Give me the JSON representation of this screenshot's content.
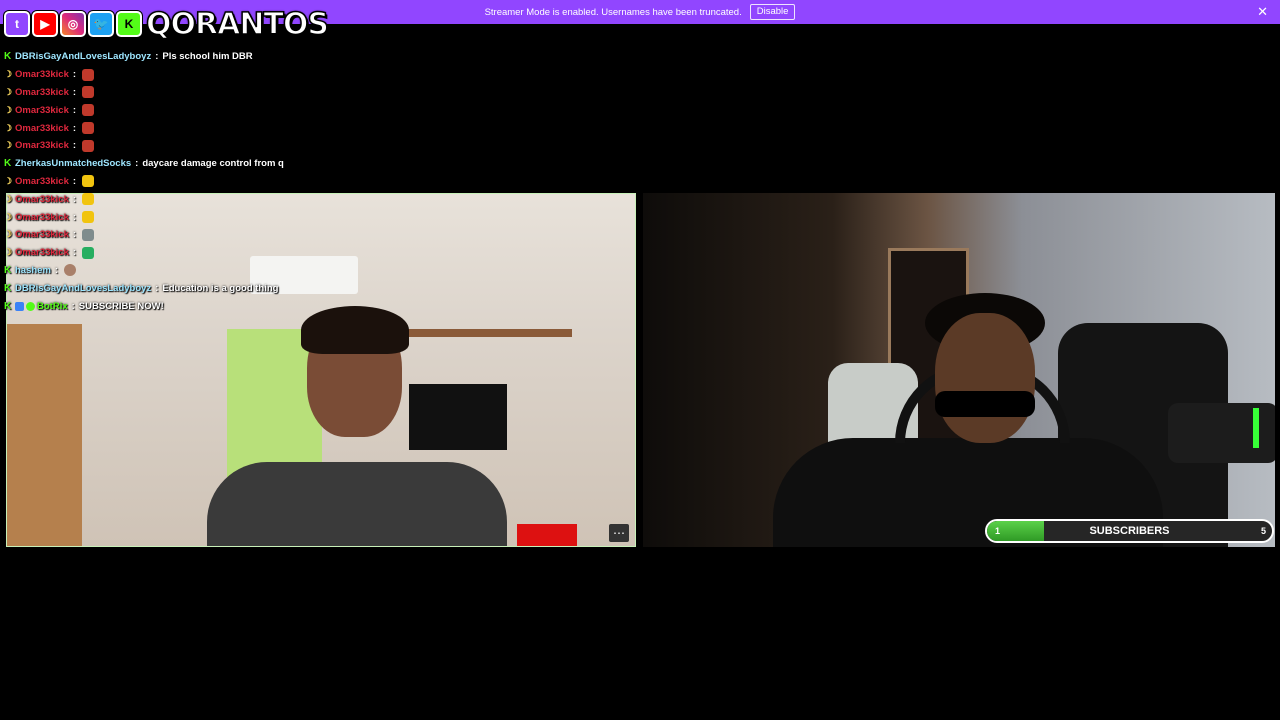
{
  "banner": {
    "message": "Streamer Mode is enabled. Usernames have been truncated.",
    "disable_label": "Disable",
    "close_glyph": "✕"
  },
  "logo": {
    "text": "QORANTOS",
    "socials": [
      "twitch-icon",
      "youtube-icon",
      "instagram-icon",
      "twitter-icon",
      "kick-icon"
    ]
  },
  "chat": [
    {
      "badge": "kick",
      "user": "DBRisGayAndLovesLadyboyz",
      "user_color": "#9ee6ff",
      "text": "Pls school him DBR",
      "emote": ""
    },
    {
      "badge": "moon",
      "user": "Omar33kick",
      "user_color": "#e0283e",
      "text": "",
      "emote": "red"
    },
    {
      "badge": "moon",
      "user": "Omar33kick",
      "user_color": "#e0283e",
      "text": "",
      "emote": "red"
    },
    {
      "badge": "moon",
      "user": "Omar33kick",
      "user_color": "#e0283e",
      "text": "",
      "emote": "red"
    },
    {
      "badge": "moon",
      "user": "Omar33kick",
      "user_color": "#e0283e",
      "text": "",
      "emote": "red"
    },
    {
      "badge": "moon",
      "user": "Omar33kick",
      "user_color": "#e0283e",
      "text": "",
      "emote": "red"
    },
    {
      "badge": "kick",
      "user": "ZherkasUnmatchedSocks",
      "user_color": "#9ee6ff",
      "text": "daycare damage control from q",
      "emote": ""
    },
    {
      "badge": "moon",
      "user": "Omar33kick",
      "user_color": "#e0283e",
      "text": "",
      "emote": "yellow"
    },
    {
      "badge": "moon",
      "user": "Omar33kick",
      "user_color": "#e0283e",
      "text": "",
      "emote": "yellow"
    },
    {
      "badge": "moon",
      "user": "Omar33kick",
      "user_color": "#e0283e",
      "text": "",
      "emote": "yellow"
    },
    {
      "badge": "moon",
      "user": "Omar33kick",
      "user_color": "#e0283e",
      "text": "",
      "emote": "gray"
    },
    {
      "badge": "moon",
      "user": "Omar33kick",
      "user_color": "#e0283e",
      "text": "",
      "emote": "green"
    },
    {
      "badge": "kick",
      "user": "hashem",
      "user_color": "#9ee6ff",
      "text": "",
      "emote": "tan"
    },
    {
      "badge": "kick",
      "user": "DBRisGayAndLovesLadyboyz",
      "user_color": "#9ee6ff",
      "text": "Education is a good thing",
      "emote": ""
    },
    {
      "badge": "bot",
      "user": "BotRix",
      "user_color": "#53fc18",
      "text": "SUBSCRIBE NOW!",
      "emote": ""
    }
  ],
  "cams": {
    "left_more_glyph": "⋯"
  },
  "subscribers": {
    "label": "SUBSCRIBERS",
    "current": "1",
    "goal": "5",
    "progress_fraction": 0.2
  },
  "colors": {
    "banner": "#9146ff",
    "kick_green": "#53fc18",
    "moderator_red": "#e0283e",
    "username_blue": "#9ee6ff"
  }
}
